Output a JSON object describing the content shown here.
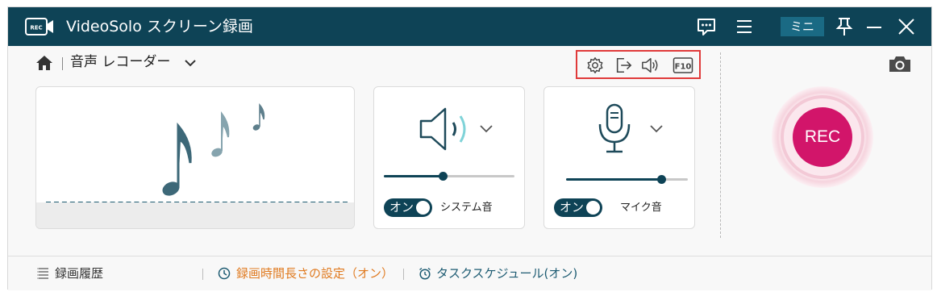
{
  "window": {
    "title": "VideoSolo スクリーン録画",
    "logo_text": "REC",
    "mini_label": "ミニ"
  },
  "mode": {
    "label": "音声 レコーダー"
  },
  "sound_panel": {
    "toggle_label": "オン",
    "label": "システム音",
    "volume": 0.45
  },
  "mic_panel": {
    "toggle_label": "オン",
    "label": "マイク音",
    "volume": 0.78
  },
  "rec_button": {
    "label": "REC"
  },
  "footer": {
    "history_label": "録画履歴",
    "duration_label": "録画時間長さの設定（オン）",
    "schedule_label": "タスクスケジュール(オン)"
  },
  "colors": {
    "titlebar": "#0e4356",
    "accent": "#0e4356",
    "rec": "#d2156a",
    "highlight_box": "#e03a3a",
    "footer_orange": "#e07a1f",
    "footer_blue": "#1d5b72"
  },
  "icons": [
    "app-logo-icon",
    "feedback-icon",
    "menu-icon",
    "pin-icon",
    "minimize-icon",
    "close-icon",
    "home-icon",
    "chevron-down-icon",
    "settings-icon",
    "export-icon",
    "speaker-icon",
    "hotkey-icon",
    "camera-icon",
    "microphone-icon",
    "music-notes-icon",
    "list-icon",
    "clock-icon",
    "alarm-icon"
  ]
}
